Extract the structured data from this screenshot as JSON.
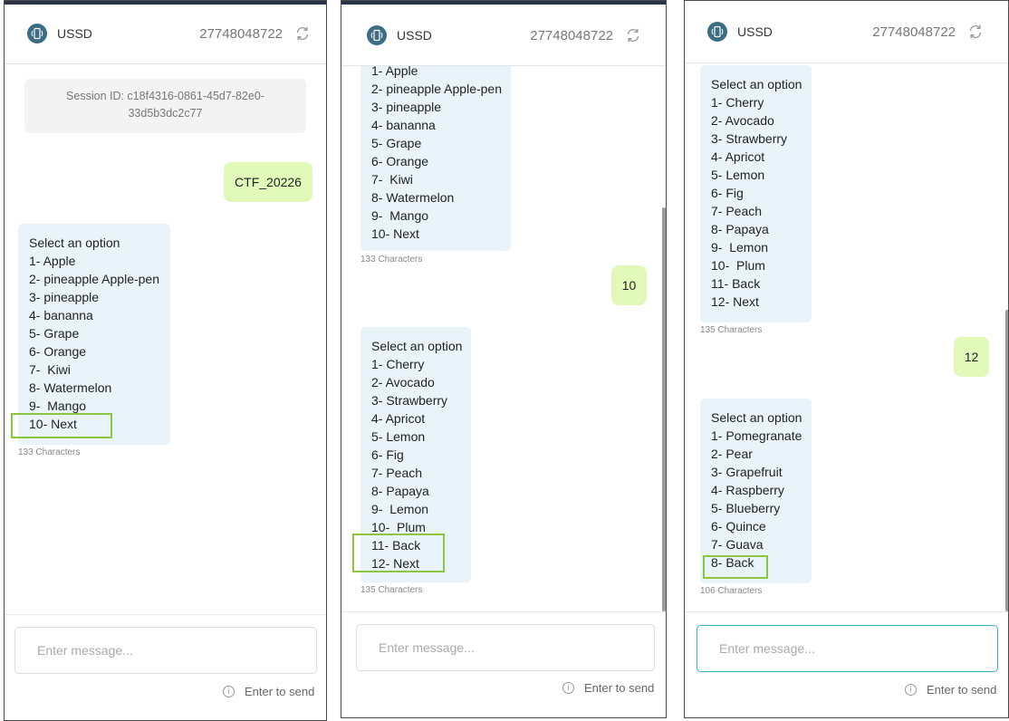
{
  "app_name": "USSD",
  "phone": "27748048722",
  "input_placeholder": "Enter message...",
  "send_hint": "Enter to send",
  "colors": {
    "accent_green": "#8cc63f",
    "incoming_bubble": "#e8f4fa",
    "outgoing_bubble": "#e1f9b9",
    "focus_border": "#33b5c5"
  },
  "panel1": {
    "session_id": "Session ID: c18f4316-0861-45d7-82e0-33d5b3dc2c77",
    "sent": "CTF_20226",
    "menu": "Select an option\n1- Apple\n2- pineapple Apple-pen\n3- pineapple\n4- bananna\n5- Grape\n6- Orange\n7-  Kiwi\n8- Watermelon\n9-  Mango\n10- Next",
    "count": "133 Characters"
  },
  "panel2": {
    "menu1": "1- Apple\n2- pineapple Apple-pen\n3- pineapple\n4- bananna\n5- Grape\n6- Orange\n7-  Kiwi\n8- Watermelon\n9-  Mango\n10- Next",
    "count1": "133 Characters",
    "sent": "10",
    "menu2": "Select an option\n1- Cherry\n2- Avocado\n3- Strawberry\n4- Apricot\n5- Lemon\n6- Fig\n7- Peach\n8- Papaya\n9-  Lemon\n10-  Plum\n11- Back\n12- Next",
    "count2": "135 Characters"
  },
  "panel3": {
    "menu1": "Select an option\n1- Cherry\n2- Avocado\n3- Strawberry\n4- Apricot\n5- Lemon\n6- Fig\n7- Peach\n8- Papaya\n9-  Lemon\n10-  Plum\n11- Back\n12- Next",
    "count1": "135 Characters",
    "sent": "12",
    "menu2": "Select an option\n1- Pomegranate\n2- Pear\n3- Grapefruit\n4- Raspberry\n5- Blueberry\n6- Quince\n7- Guava\n8- Back",
    "count2": "106 Characters"
  }
}
